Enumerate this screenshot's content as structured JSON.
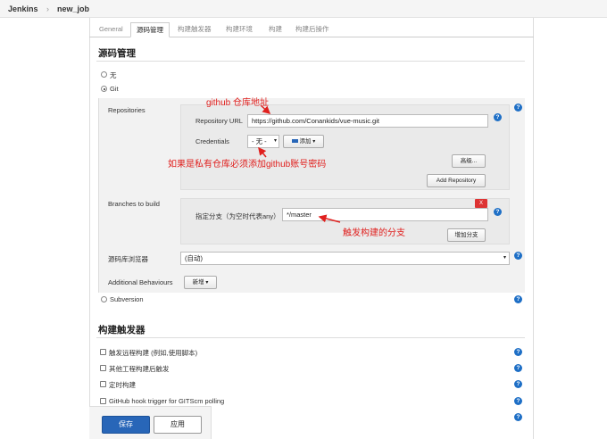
{
  "breadcrumb": {
    "root": "Jenkins",
    "job": "new_job",
    "separator": "›"
  },
  "tabs": [
    "General",
    "源码管理",
    "构建触发器",
    "构建环境",
    "构建",
    "构建后操作"
  ],
  "scm": {
    "title": "源码管理",
    "options": {
      "none": "无",
      "git": "Git",
      "subversion": "Subversion"
    },
    "repositories_label": "Repositories",
    "repo_url_label": "Repository URL",
    "repo_url_value": "https://github.com/Conankids/vue-music.git",
    "credentials_label": "Credentials",
    "credentials_value": "- 无 -",
    "add_button": "添加",
    "advanced_button": "高级...",
    "add_repository_button": "Add Repository",
    "branches_label": "Branches to build",
    "branch_spec_label": "指定分支（为空时代表any）",
    "branch_spec_value": "*/master",
    "remove_x": "X",
    "add_branch_button": "增加分支",
    "browser_label": "源码库浏览器",
    "browser_value": "(自动)",
    "behaviours_label": "Additional Behaviours",
    "new_button": "新增"
  },
  "annotations": {
    "repo_note": "github 仓库地址",
    "credentials_note": "如果是私有仓库必须添加github账号密码",
    "branch_note": "触发构建的分支"
  },
  "triggers": {
    "title": "构建触发器",
    "items": [
      "触发远程构建 (例如,使用脚本)",
      "其他工程构建后触发",
      "定时构建",
      "GitHub hook trigger for GITScm polling"
    ]
  },
  "actions": {
    "save": "保存",
    "apply": "应用"
  },
  "help_glyph": "?",
  "colors": {
    "accent": "#2866b8",
    "annotation": "#e0201e",
    "help": "#1e6fc6"
  }
}
